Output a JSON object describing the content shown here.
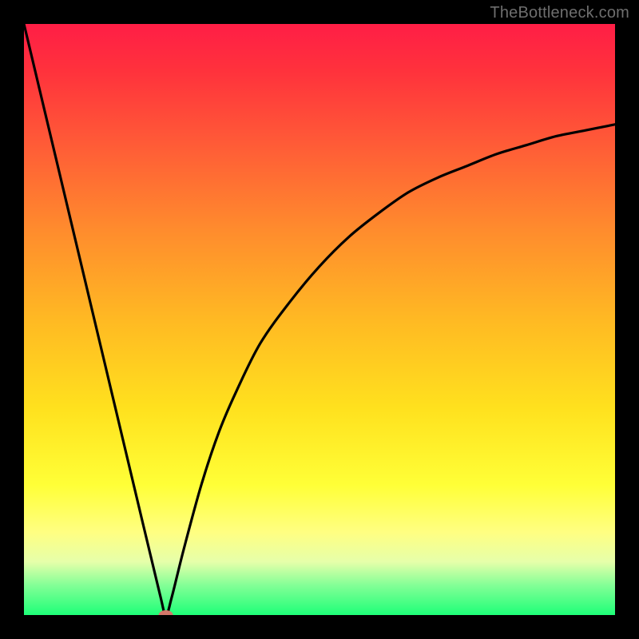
{
  "attribution": "TheBottleneck.com",
  "chart_data": {
    "type": "line",
    "title": "",
    "xlabel": "",
    "ylabel": "",
    "xlim": [
      0,
      100
    ],
    "ylim": [
      0,
      100
    ],
    "series": [
      {
        "name": "bottleneck-curve",
        "x": [
          0,
          5,
          10,
          15,
          20,
          23,
          24,
          25,
          27,
          30,
          33,
          36,
          40,
          45,
          50,
          55,
          60,
          65,
          70,
          75,
          80,
          85,
          90,
          95,
          100
        ],
        "values": [
          100,
          79,
          58,
          37,
          16,
          3.5,
          0,
          3,
          11,
          22,
          31,
          38,
          46,
          53,
          59,
          64,
          68,
          71.5,
          74,
          76,
          78,
          79.5,
          81,
          82,
          83
        ]
      }
    ],
    "marker": {
      "x": 24,
      "y": 0,
      "color": "#d4776a"
    },
    "gradient_colors": {
      "top": "#ff1e46",
      "middle": "#ffd21f",
      "bottom": "#1eff78"
    }
  }
}
